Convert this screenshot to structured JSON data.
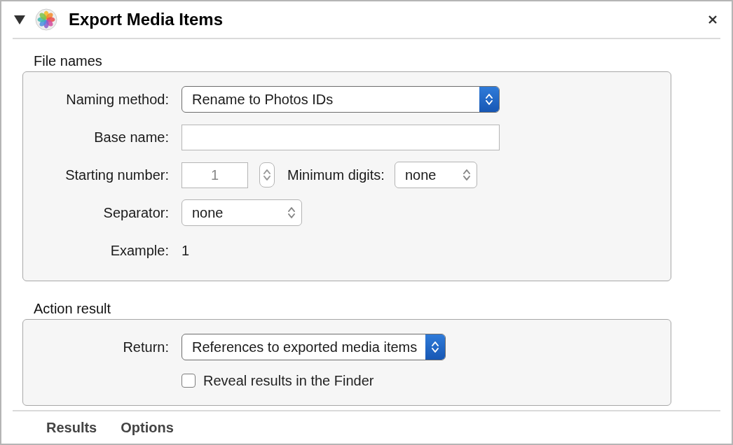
{
  "action": {
    "title": "Export Media Items",
    "expanded": true
  },
  "sections": [
    {
      "title": "File names",
      "rows": [
        {
          "kind": "popup",
          "label": "Naming method:",
          "value": "Rename to Photos IDs",
          "primary": true
        },
        {
          "kind": "text",
          "label": "Base name:"
        },
        {
          "kind": "stepper",
          "label": "Starting number:",
          "placeholder": "1",
          "extra_label": "Minimum digits:",
          "extra_value": "none"
        },
        {
          "kind": "popup",
          "label": "Separator:",
          "value": "none",
          "primary": false
        },
        {
          "kind": "example",
          "label": "Example:",
          "value": "1"
        }
      ]
    },
    {
      "title": "Action result",
      "rows": [
        {
          "kind": "popup",
          "label": "Return:",
          "value": "References to exported media items",
          "primary": true
        },
        {
          "kind": "checkbox",
          "label": "Reveal results in the Finder",
          "checked": false
        }
      ]
    }
  ],
  "footer_tabs": [
    {
      "label": "Results"
    },
    {
      "label": "Options"
    }
  ]
}
